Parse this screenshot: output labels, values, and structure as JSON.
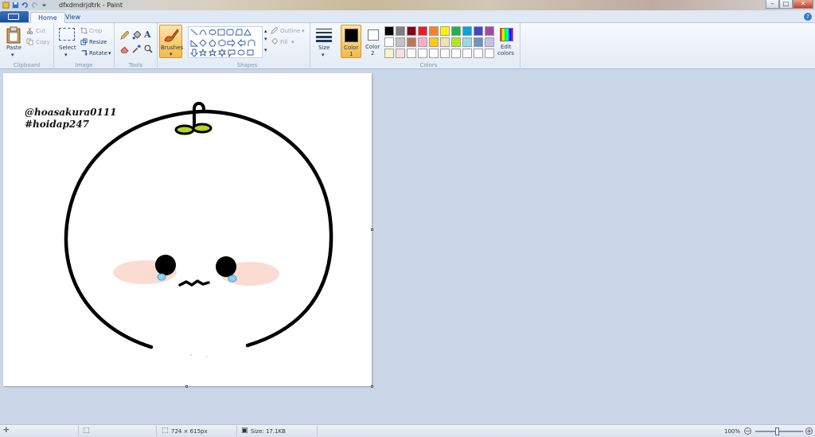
{
  "window": {
    "title": "dfxdmdrjdtrk - Paint"
  },
  "tabs": [
    {
      "label": "Home"
    },
    {
      "label": "View"
    }
  ],
  "clipboard": {
    "paste": "Paste",
    "cut": "Cut",
    "copy": "Copy",
    "group": "Clipboard"
  },
  "image": {
    "select": "Select",
    "crop": "Crop",
    "resize": "Resize",
    "rotate": "Rotate",
    "group": "Image"
  },
  "tools": {
    "group": "Tools"
  },
  "brushes": {
    "label": "Brushes"
  },
  "shapes": {
    "outline": "Outline",
    "fill": "Fill",
    "group": "Shapes"
  },
  "size": {
    "label": "Size"
  },
  "colors": {
    "color1_line1": "Color",
    "color1_line2": "1",
    "color2_line1": "Color",
    "color2_line2": "2",
    "edit_line1": "Edit",
    "edit_line2": "colors",
    "group": "Colors",
    "color1_value": "#000000",
    "color2_value": "#ffffff",
    "palette_row1": [
      "#000000",
      "#7f7f7f",
      "#880015",
      "#ed1c24",
      "#ff7f27",
      "#fff200",
      "#22b14c",
      "#00a2e8",
      "#3f48cc",
      "#a349a4"
    ],
    "palette_row2": [
      "#ffffff",
      "#c3c3c3",
      "#b97a57",
      "#ffaec9",
      "#ffc90e",
      "#efe4b0",
      "#b5e61d",
      "#99d9ea",
      "#7092be",
      "#c8bfe7"
    ],
    "palette_row3": [
      "#f5f5c8",
      "#fbe0e0",
      "#ffffff",
      "#ffffff",
      "#ffffff",
      "#ffffff",
      "#ffffff",
      "#ffffff",
      "#ffffff",
      "#ffffff"
    ]
  },
  "canvas": {
    "watermark_line1": "@hoasakura0111",
    "watermark_line2": "#hoidap247"
  },
  "status": {
    "dimensions": "724 × 615px",
    "size": "Size: 17.1KB",
    "zoom": "100%"
  }
}
